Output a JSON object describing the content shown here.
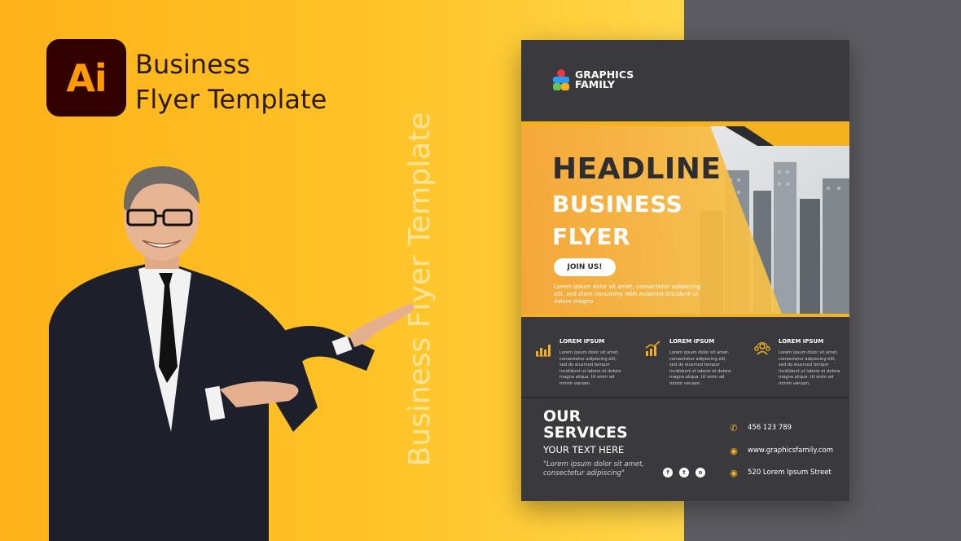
{
  "app": {
    "logo_text": "Ai",
    "title_line1": "Business",
    "title_line2": "Flyer Template",
    "vertical_label": "Business Flyer Template"
  },
  "flyer": {
    "brand_line1": "GRAPHICS",
    "brand_line2": "FAMILY",
    "headline": "HEADLINE",
    "subheadline_line1": "BUSINESS",
    "subheadline_line2": "FLYER",
    "cta_label": "JOIN US!",
    "hero_body": "Lorem ipsum dolor sit amet, consectetur adipiscing elit, sed diam nonummy nibh euismod tincidunt ut dolore magna",
    "features": [
      {
        "title": "LOREM IPSUM",
        "body": "Lorem ipsum dolor sit amet, consectetur adipiscing elit, sed do eiusmod tempor incididunt ut labore et dolore magna aliqua. Ut enim ad minim veniam.",
        "icon": "chart-icon"
      },
      {
        "title": "LOREM IPSUM",
        "body": "Lorem ipsum dolor sit amet, consectetur adipiscing elit, sed do eiusmod tempor incididunt ut labore et dolore magna aliqua. Ut enim ad minim veniam.",
        "icon": "growth-icon"
      },
      {
        "title": "LOREM IPSUM",
        "body": "Lorem ipsum dolor sit amet, consectetur adipiscing elit, sed do eiusmod tempor incididunt ut labore et dolore magna aliqua. Ut enim ad minim veniam.",
        "icon": "team-icon"
      }
    ],
    "services_line1": "OUR",
    "services_line2": "SERVICES",
    "your_text": "YOUR TEXT HERE",
    "quote": "\"Lorem ipsum dolor sit amet, consectetur adipiscing\"",
    "social": [
      "f",
      "t",
      "o"
    ],
    "phone": "456 123 789",
    "website": "www.graphicsfamily.com",
    "address": "520 Lorem Ipsum Street"
  },
  "colors": {
    "accent": "#f6b21e",
    "dark": "#3a3a3e",
    "right_panel": "#5c5c62",
    "ai_logo_bg": "#330000",
    "ai_logo_text": "#ff9a00"
  }
}
